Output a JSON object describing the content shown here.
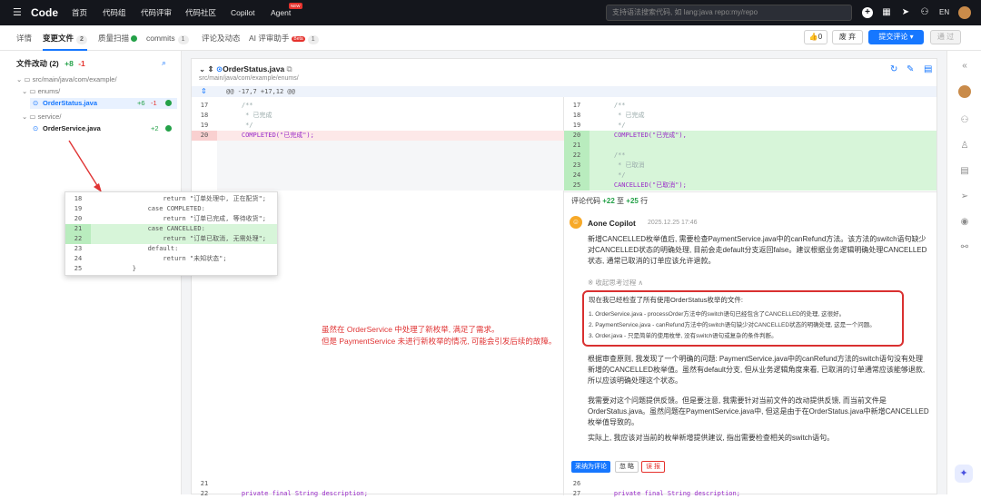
{
  "nav": {
    "logo": "Code",
    "links": [
      "首页",
      "代码组",
      "代码评审",
      "代码社区",
      "Copilot",
      "Agent"
    ],
    "new_badge": "NEW",
    "search_placeholder": "支持语法搜索代码, 如 lang:java repo:my/repo",
    "lang": "EN"
  },
  "tabs": [
    {
      "label": "详情"
    },
    {
      "label": "变更文件",
      "count": "2"
    },
    {
      "label": "质量扫描"
    },
    {
      "label": "commits",
      "count": "1"
    },
    {
      "label": "评论及动态"
    },
    {
      "label": "AI 评审助手",
      "badge": "Beta",
      "count": "1"
    }
  ],
  "actions": {
    "like_count": "0",
    "discard": "废 弃",
    "submit": "提交评论",
    "approve": "通 过"
  },
  "files": {
    "title": "文件改动 (2)",
    "add": "+8",
    "del": "-1",
    "tree": [
      {
        "path": "src/main/java/com/example/"
      },
      {
        "path": "enums/"
      },
      {
        "file": "OrderStatus.java",
        "add": "+6",
        "del": "-1"
      },
      {
        "path": "service/"
      },
      {
        "file": "OrderService.java",
        "add": "+2"
      }
    ]
  },
  "diff": {
    "filename": "OrderStatus.java",
    "path": "src/main/java/com/example/enums/",
    "hunk": "@@ -17,7 +17,12 @@",
    "left": [
      {
        "n": "17",
        "t": "    /**"
      },
      {
        "n": "18",
        "t": "     * 已完成"
      },
      {
        "n": "19",
        "t": "     */"
      },
      {
        "n": "20",
        "t": "    COMPLETED(\"已完成\");"
      }
    ],
    "right": [
      {
        "n": "17",
        "t": "    /**"
      },
      {
        "n": "18",
        "t": "     * 已完成"
      },
      {
        "n": "19",
        "t": "     */"
      },
      {
        "n": "20",
        "t": "    COMPLETED(\"已完成\"),"
      },
      {
        "n": "21",
        "t": ""
      },
      {
        "n": "22",
        "t": "    /**"
      },
      {
        "n": "23",
        "t": "     * 已取消"
      },
      {
        "n": "24",
        "t": "     */"
      },
      {
        "n": "25",
        "t": "    CANCELLED(\"已取消\");"
      }
    ],
    "range": {
      "label": "评论代码",
      "from": "+22",
      "to_word": "至",
      "to": "+25",
      "unit": "行"
    },
    "bottom_left": [
      {
        "n": "21",
        "t": ""
      },
      {
        "n": "22",
        "t": "    private final String description;"
      }
    ],
    "bottom_right": [
      {
        "n": "26",
        "t": ""
      },
      {
        "n": "27",
        "t": "    private final String description;"
      }
    ]
  },
  "ai": {
    "name": "Aone Copilot",
    "time": "2025.12.25 17:46",
    "p1": "新增CANCELLED枚举值后, 需要检查PaymentService.java中的canRefund方法。该方法的switch语句缺少对CANCELLED状态的明确处理, 目前会走default分支返回false。建议根据业务逻辑明确处理CANCELLED状态, 通常已取消的订单应该允许退款。",
    "fold": "※ 收起思考过程 ∧",
    "think_title": "现在我已经检查了所有使用OrderStatus枚举的文件:",
    "think_items": [
      "OrderService.java - processOrder方法中的switch语句已经包含了CANCELLED的处理, 这很好。",
      "PaymentService.java - canRefund方法中的switch语句缺少对CANCELLED状态的明确处理, 这是一个问题。",
      "Order.java - 只是简单的使用枚举, 没有switch语句或复杂的条件判断。"
    ],
    "p2": "根据审查原则, 我发现了一个明确的问题: PaymentService.java中的canRefund方法的switch语句没有处理新增的CANCELLED枚举值。虽然有default分支, 但从业务逻辑角度来看, 已取消的订单通常应该能够退款, 所以应该明确处理这个状态。",
    "p3": "我需要对这个问题提供反馈。但是要注意, 我需要针对当前文件的改动提供反馈, 而当前文件是OrderStatus.java。虽然问题在PaymentService.java中, 但这是由于在OrderStatus.java中新增CANCELLED枚举值导致的。",
    "p4": "实际上, 我应该对当前的枚举新增提供建议, 指出需要检查相关的switch语句。",
    "btn_adopt": "采纳为评论",
    "btn_ignore": "忽 略",
    "btn_wrong": "误 报"
  },
  "popup": [
    {
      "n": "18",
      "t": "                return \"订单处理中, 正在配货\";"
    },
    {
      "n": "19",
      "t": "            case COMPLETED:"
    },
    {
      "n": "20",
      "t": "                return \"订单已完成, 等待收货\";"
    },
    {
      "n": "21",
      "t": "            case CANCELLED:"
    },
    {
      "n": "22",
      "t": "                return \"订单已取消, 无需处理\";"
    },
    {
      "n": "23",
      "t": "            default:"
    },
    {
      "n": "24",
      "t": "                return \"未知状态\";"
    },
    {
      "n": "25",
      "t": "        }"
    }
  ],
  "annotation": {
    "line1": "虽然在 OrderService 中处理了新枚举, 满足了需求。",
    "line2": "但是 PaymentService 未进行新枚举的情况, 可能会引发后续的故障。"
  },
  "colors": {
    "accent": "#1677ff",
    "add": "#24a148",
    "del": "#e5322d",
    "annotation": "#e03434"
  }
}
